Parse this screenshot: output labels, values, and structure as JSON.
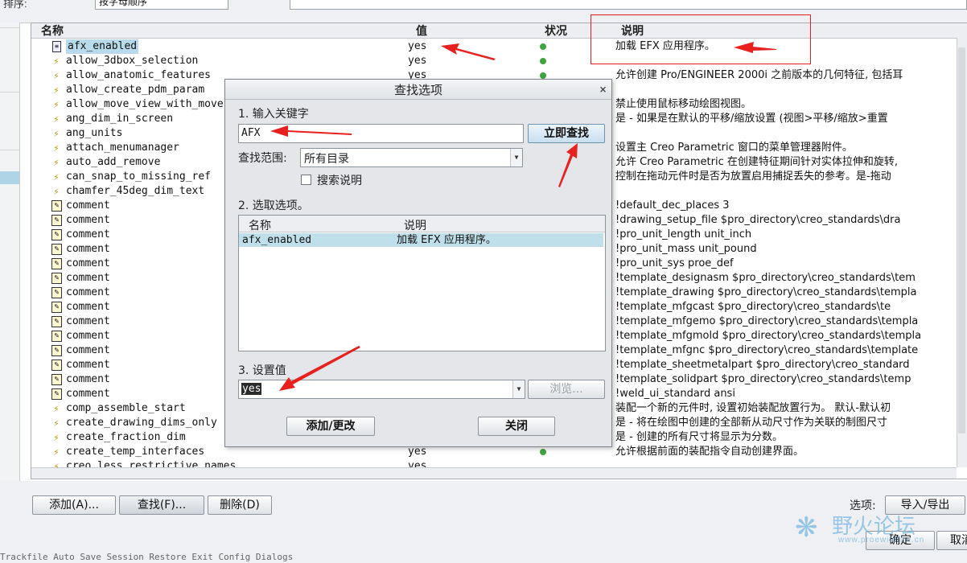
{
  "top": {
    "filter_label": "排序:",
    "sort_value": "按字母顺序"
  },
  "table": {
    "headers": {
      "name": "名称",
      "value": "值",
      "status": "状况",
      "desc": "说明"
    },
    "rows": [
      {
        "icon": "doc",
        "name": "afx_enabled",
        "value": "yes",
        "dot": true,
        "desc": "加载 EFX 应用程序。",
        "selected": true
      },
      {
        "icon": "bolt",
        "name": "allow_3dbox_selection",
        "value": "yes",
        "dot": true,
        "desc": ""
      },
      {
        "icon": "bolt",
        "name": "allow_anatomic_features",
        "value": "yes",
        "dot": true,
        "desc": "允许创建 Pro/ENGINEER 2000i 之前版本的几何特征, 包括耳"
      },
      {
        "icon": "bolt",
        "name": "allow_create_pdm_param",
        "value": "",
        "dot": false,
        "desc": ""
      },
      {
        "icon": "bolt",
        "name": "allow_move_view_with_move",
        "value": "",
        "dot": false,
        "desc": "禁止使用鼠标移动绘图视图。"
      },
      {
        "icon": "bolt",
        "name": "ang_dim_in_screen",
        "value": "",
        "dot": false,
        "desc": "是 - 如果是在默认的平移/缩放设置 (视图>平移/缩放>重置"
      },
      {
        "icon": "bolt",
        "name": "ang_units",
        "value": "",
        "dot": false,
        "desc": ""
      },
      {
        "icon": "bolt",
        "name": "attach_menumanager",
        "value": "",
        "dot": false,
        "desc": "设置主 Creo Parametric 窗口的菜单管理器附件。"
      },
      {
        "icon": "bolt",
        "name": "auto_add_remove",
        "value": "",
        "dot": false,
        "desc": "允许 Creo Parametric 在创建特征期间针对实体拉伸和旋转,"
      },
      {
        "icon": "bolt",
        "name": "can_snap_to_missing_ref",
        "value": "",
        "dot": false,
        "desc": "控制在拖动元件时是否为放置启用捕捉丢失的参考。是-拖动"
      },
      {
        "icon": "bolt",
        "name": "chamfer_45deg_dim_text",
        "value": "",
        "dot": false,
        "desc": ""
      },
      {
        "icon": "note",
        "name": "comment",
        "value": "",
        "dot": false,
        "desc": "!default_dec_places 3"
      },
      {
        "icon": "note",
        "name": "comment",
        "value": "",
        "dot": false,
        "desc": "!drawing_setup_file $pro_directory\\creo_standards\\dra"
      },
      {
        "icon": "note",
        "name": "comment",
        "value": "",
        "dot": false,
        "desc": "!pro_unit_length unit_inch"
      },
      {
        "icon": "note",
        "name": "comment",
        "value": "",
        "dot": false,
        "desc": "!pro_unit_mass unit_pound"
      },
      {
        "icon": "note",
        "name": "comment",
        "value": "",
        "dot": false,
        "desc": "!pro_unit_sys proe_def"
      },
      {
        "icon": "note",
        "name": "comment",
        "value": "",
        "dot": false,
        "desc": "!template_designasm $pro_directory\\creo_standards\\tem"
      },
      {
        "icon": "note",
        "name": "comment",
        "value": "",
        "dot": false,
        "desc": "!template_drawing $pro_directory\\creo_standards\\templa"
      },
      {
        "icon": "note",
        "name": "comment",
        "value": "",
        "dot": false,
        "desc": "!template_mfgcast $pro_directory\\creo_standards\\te"
      },
      {
        "icon": "note",
        "name": "comment",
        "value": "",
        "dot": false,
        "desc": "!template_mfgemo $pro_directory\\creo_standards\\templa"
      },
      {
        "icon": "note",
        "name": "comment",
        "value": "",
        "dot": false,
        "desc": "!template_mfgmold $pro_directory\\creo_standards\\templa"
      },
      {
        "icon": "note",
        "name": "comment",
        "value": "",
        "dot": false,
        "desc": "!template_mfgnc $pro_directory\\creo_standards\\template"
      },
      {
        "icon": "note",
        "name": "comment",
        "value": "",
        "dot": false,
        "desc": "!template_sheetmetalpart $pro_directory\\creo_standard"
      },
      {
        "icon": "note",
        "name": "comment",
        "value": "",
        "dot": false,
        "desc": "!template_solidpart $pro_directory\\creo_standards\\temp"
      },
      {
        "icon": "note",
        "name": "comment",
        "value": "",
        "dot": false,
        "desc": "!weld_ui_standard ansi"
      },
      {
        "icon": "bolt",
        "name": "comp_assemble_start",
        "value": "",
        "dot": false,
        "desc": "装配一个新的元件时, 设置初始装配放置行为。 默认-默认初"
      },
      {
        "icon": "bolt",
        "name": "create_drawing_dims_only",
        "value": "",
        "dot": false,
        "desc": "是 - 将在绘图中创建的全部新从动尺寸作为关联的制图尺寸"
      },
      {
        "icon": "bolt",
        "name": "create_fraction_dim",
        "value": "",
        "dot": false,
        "desc": "是 - 创建的所有尺寸将显示为分数。"
      },
      {
        "icon": "bolt",
        "name": "create_temp_interfaces",
        "value": "yes",
        "dot": true,
        "desc": "允许根据前面的装配指令自动创建界面。"
      },
      {
        "icon": "bolt",
        "name": "creo_less_restrictive_names",
        "value": "yes",
        "dot": false,
        "desc": ""
      }
    ]
  },
  "dialog": {
    "title": "查找选项",
    "close": "×",
    "step1": "1.  输入关键字",
    "keyword": "AFX",
    "search_now": "立即查找",
    "scope_label": "查找范围:",
    "scope_value": "所有目录",
    "search_desc_label": "搜索说明",
    "search_desc_checked": false,
    "step2": "2.  选取选项。",
    "list_headers": {
      "name": "名称",
      "desc": "说明"
    },
    "list_rows": [
      {
        "name": "afx_enabled",
        "desc": "加载 EFX 应用程序。"
      }
    ],
    "step3": "3.  设置值",
    "value": "yes",
    "browse": "浏览...",
    "add_change": "添加/更改",
    "close_btn": "关闭"
  },
  "bottom": {
    "add_btn": "添加(A)...",
    "find_btn": "查找(F)...",
    "delete_btn": "删除(D)",
    "options_label": "选项:",
    "import_export": "导入/导出",
    "ok_btn": "确定",
    "cancel_btn": "取消",
    "status": "Trackfile  Auto  Save  Session  Restore  Exit  Config  Dialogs"
  },
  "watermark": {
    "text": "野火论坛",
    "sub": "www.proewildfire.cn"
  },
  "colors": {
    "annotation_red": "#e02020",
    "selection_blue": "#b7dbea",
    "status_green": "#3fa33f"
  }
}
